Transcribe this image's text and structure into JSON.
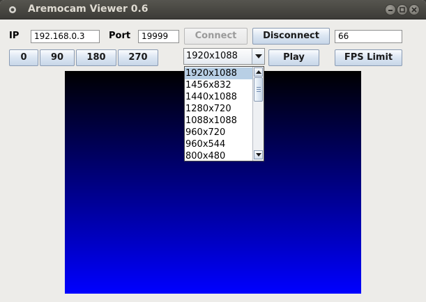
{
  "window": {
    "title": "Aremocam Viewer 0.6",
    "controls": [
      "minimize",
      "maximize",
      "close"
    ]
  },
  "connection": {
    "ip_label": "IP",
    "ip_value": "192.168.0.3",
    "port_label": "Port",
    "port_value": "19999",
    "connect_label": "Connect",
    "connect_enabled": false,
    "disconnect_label": "Disconnect",
    "fps_value": "66"
  },
  "rotation": {
    "buttons": [
      "0",
      "90",
      "180",
      "270"
    ]
  },
  "resolution": {
    "selected": "1920x1088",
    "options": [
      "1920x1088",
      "1456x832",
      "1440x1088",
      "1280x720",
      "1088x1088",
      "960x720",
      "960x544",
      "800x480"
    ],
    "highlighted_index": 0
  },
  "playback": {
    "play_label": "Play",
    "fps_limit_label": "FPS Limit"
  },
  "video": {
    "gradient_top": "#000000",
    "gradient_bottom": "#0000ff"
  },
  "icons": {
    "app": "camera-icon",
    "dropdown_arrow": "triangle-down-icon"
  }
}
